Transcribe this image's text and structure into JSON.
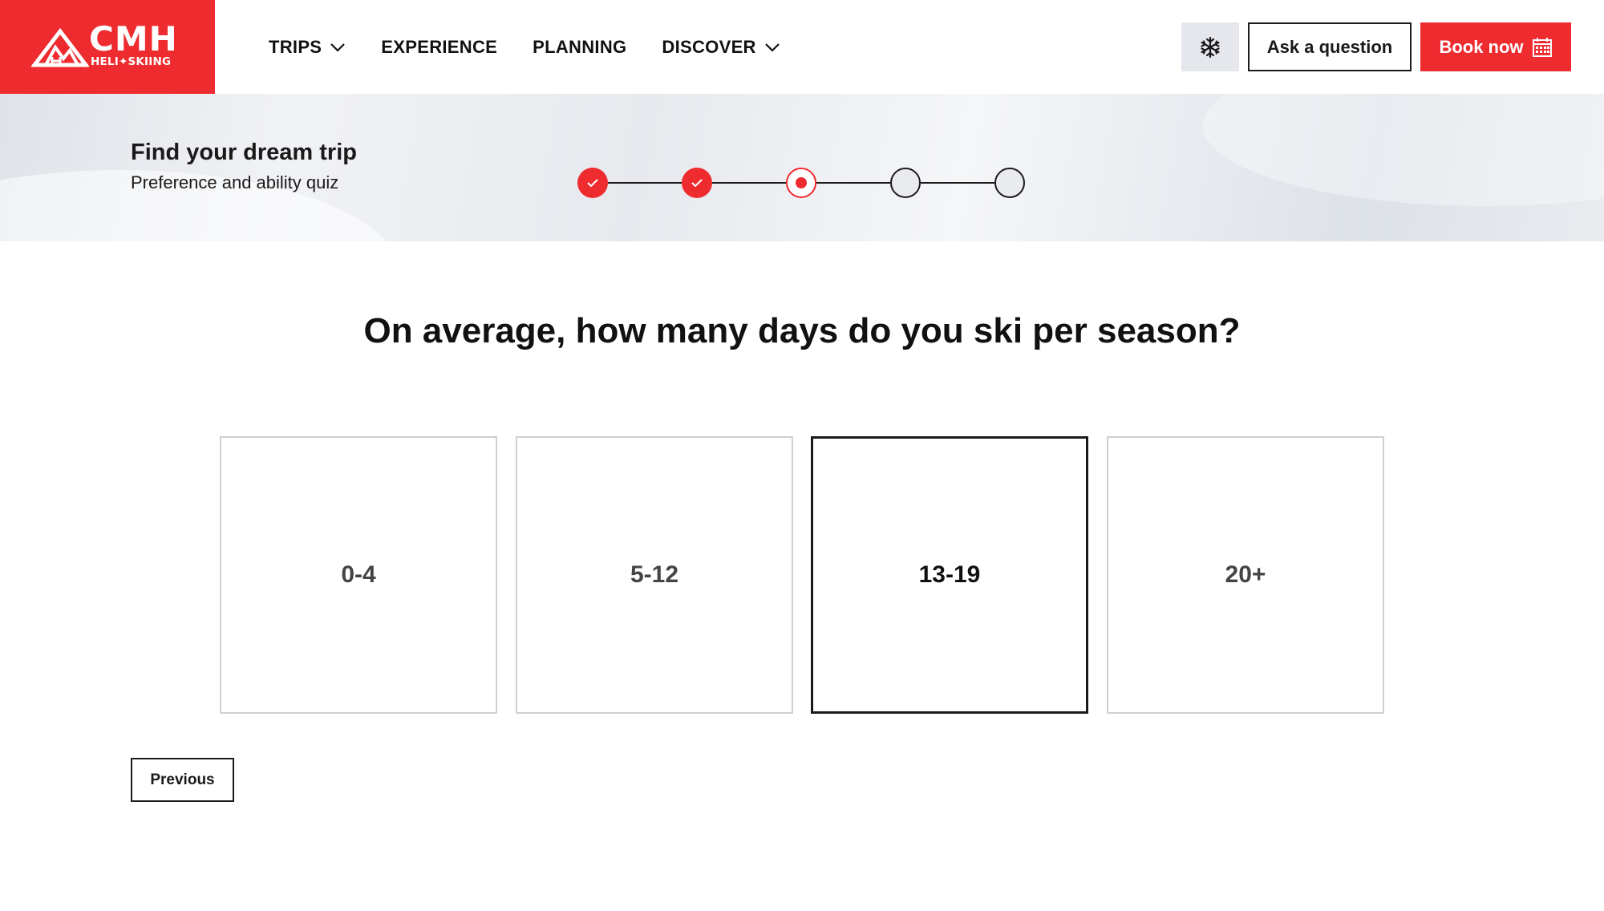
{
  "brand": {
    "name": "CMH",
    "tagline": "HELI✦SKIING",
    "accent": "#ee2b2f"
  },
  "nav": {
    "items": [
      {
        "label": "TRIPS",
        "has_dropdown": true
      },
      {
        "label": "EXPERIENCE",
        "has_dropdown": false
      },
      {
        "label": "PLANNING",
        "has_dropdown": false
      },
      {
        "label": "DISCOVER",
        "has_dropdown": true
      }
    ],
    "snow_icon": "snowflake-icon",
    "ask_label": "Ask a question",
    "book_label": "Book now",
    "book_icon": "calendar-icon"
  },
  "hero": {
    "title": "Find your dream trip",
    "subtitle": "Preference and ability quiz",
    "steps": [
      "done",
      "done",
      "current",
      "todo",
      "todo"
    ]
  },
  "quiz": {
    "question": "On average, how many days do you ski per season?",
    "options": [
      {
        "label": "0-4",
        "selected": false
      },
      {
        "label": "5-12",
        "selected": false
      },
      {
        "label": "13-19",
        "selected": true
      },
      {
        "label": "20+",
        "selected": false
      }
    ],
    "previous_label": "Previous"
  }
}
